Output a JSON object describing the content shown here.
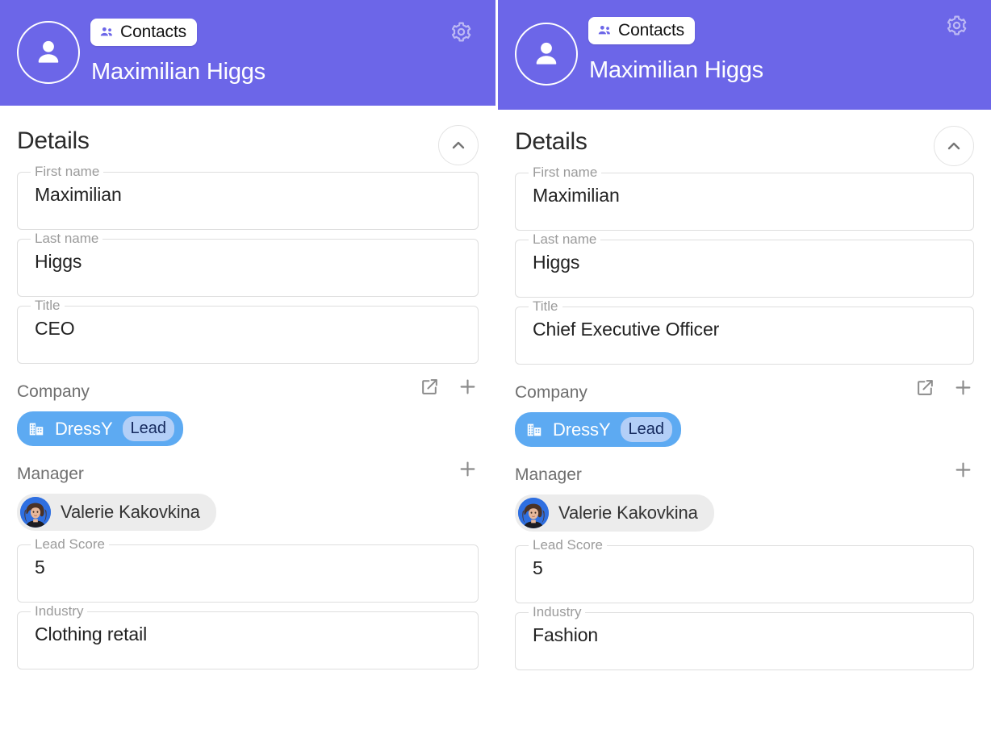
{
  "colors": {
    "header_purple": "#6C66E8",
    "chip_blue": "#5DAAF2",
    "lead_badge_blue": "#B3CFF7",
    "manager_chip_gray": "#ececec",
    "field_border": "#dedede",
    "label_gray": "#9b9b9b"
  },
  "panels": [
    {
      "id": "left",
      "header": {
        "avatar_icon": "person-circle-icon",
        "module_chip": {
          "label": "Contacts",
          "icon": "group-people-icon"
        },
        "record_name": "Maximilian Higgs",
        "settings_icon": "gear-icon"
      },
      "section": {
        "title": "Details",
        "collapse_icon": "chevron-up-icon"
      },
      "fields": [
        {
          "label": "First name",
          "value": "Maximilian"
        },
        {
          "label": "Last name",
          "value": "Higgs"
        },
        {
          "label": "Title",
          "value": "CEO"
        }
      ],
      "company": {
        "label": "Company",
        "open_icon": "open-in-new-icon",
        "add_icon": "plus-icon",
        "chip": {
          "icon": "building-icon",
          "name": "DressY",
          "badge": "Lead"
        }
      },
      "manager": {
        "label": "Manager",
        "add_icon": "plus-icon",
        "chip": {
          "avatar": "photo-avatar",
          "name": "Valerie Kakovkina"
        }
      },
      "fields_bottom": [
        {
          "label": "Lead Score",
          "value": "5"
        },
        {
          "label": "Industry",
          "value": "Clothing retail"
        }
      ]
    },
    {
      "id": "right",
      "header": {
        "avatar_icon": "person-circle-icon",
        "module_chip": {
          "label": "Contacts",
          "icon": "group-people-icon"
        },
        "record_name": "Maximilian Higgs",
        "settings_icon": "gear-icon"
      },
      "section": {
        "title": "Details",
        "collapse_icon": "chevron-up-icon"
      },
      "fields": [
        {
          "label": "First name",
          "value": "Maximilian"
        },
        {
          "label": "Last name",
          "value": "Higgs"
        },
        {
          "label": "Title",
          "value": "Chief Executive Officer"
        }
      ],
      "company": {
        "label": "Company",
        "open_icon": "open-in-new-icon",
        "add_icon": "plus-icon",
        "chip": {
          "icon": "building-icon",
          "name": "DressY",
          "badge": "Lead"
        }
      },
      "manager": {
        "label": "Manager",
        "add_icon": "plus-icon",
        "chip": {
          "avatar": "photo-avatar",
          "name": "Valerie Kakovkina"
        }
      },
      "fields_bottom": [
        {
          "label": "Lead Score",
          "value": "5"
        },
        {
          "label": "Industry",
          "value": "Fashion"
        }
      ]
    }
  ]
}
